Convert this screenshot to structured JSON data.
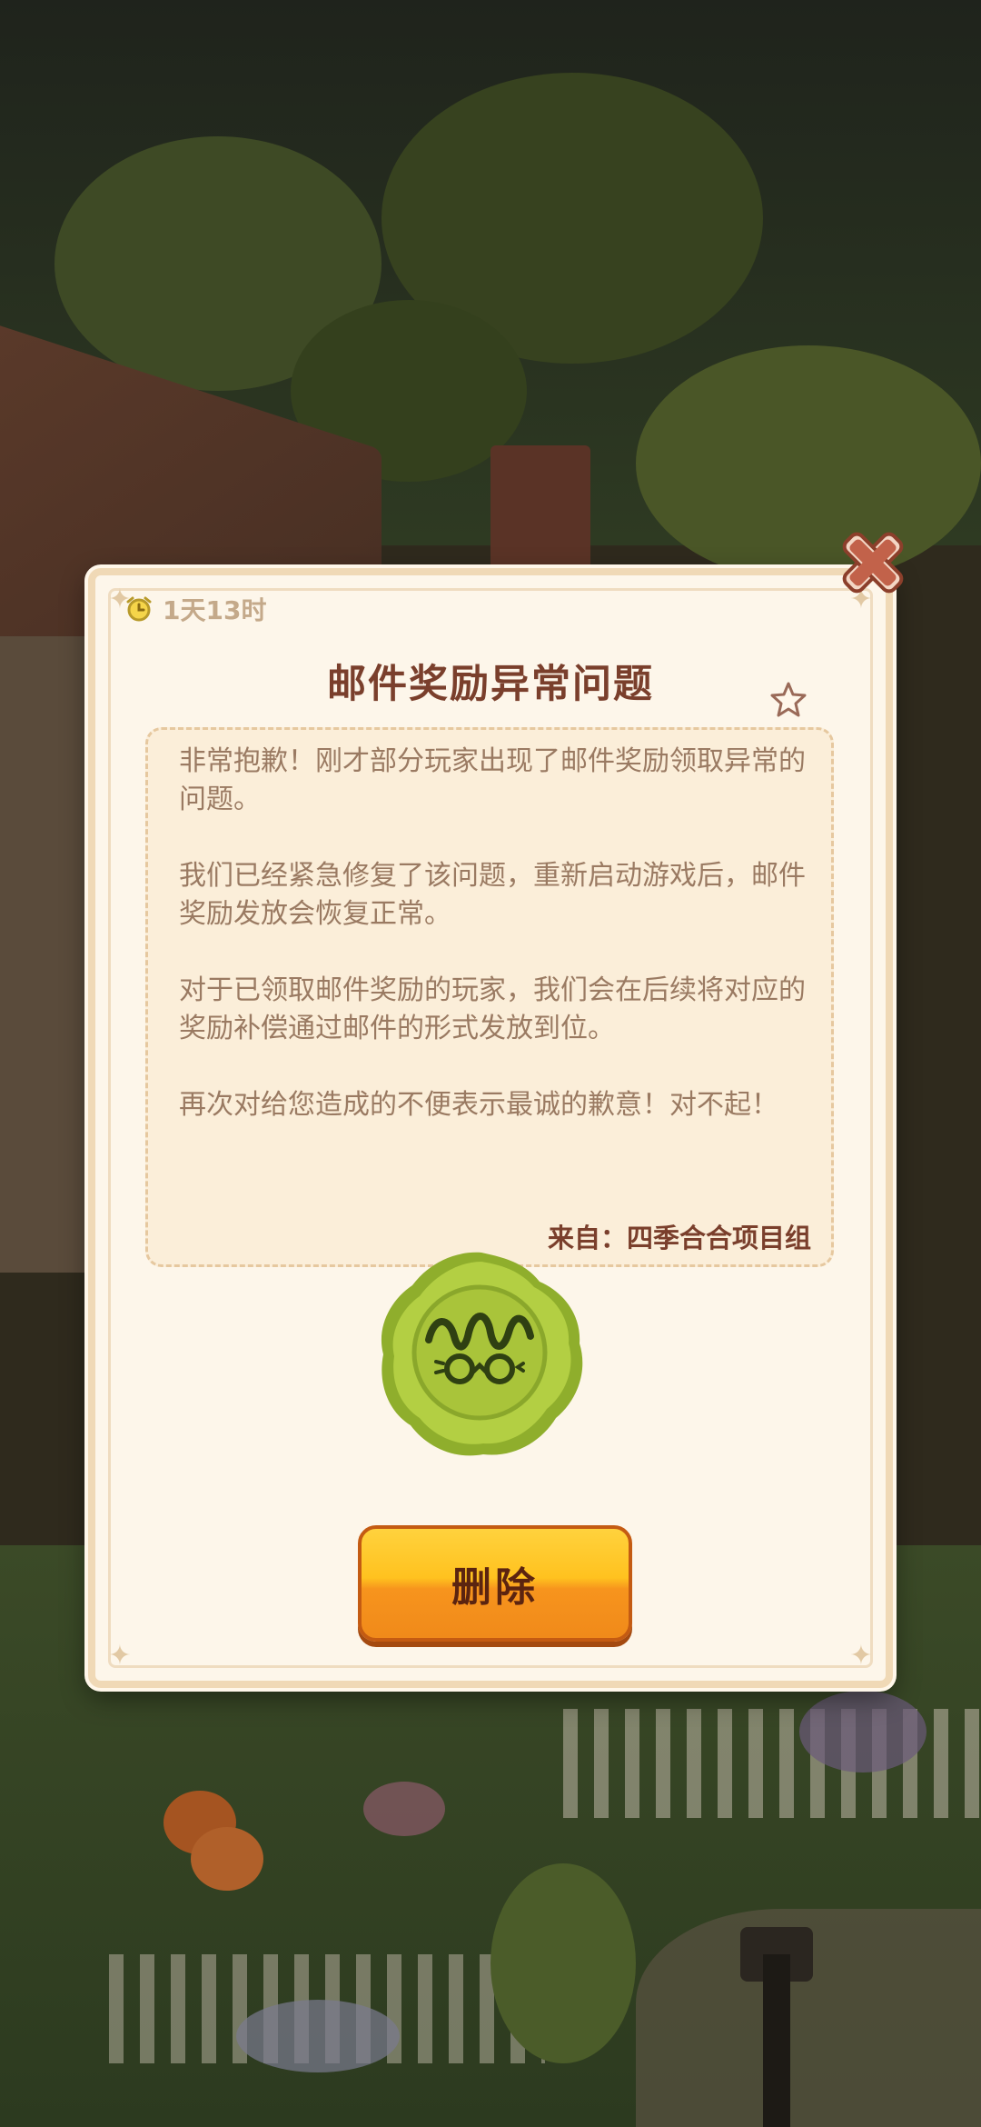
{
  "mail": {
    "timer": "1天13时",
    "title": "邮件奖励异常问题",
    "paragraphs": [
      "非常抱歉！刚才部分玩家出现了邮件奖励领取异常的问题。",
      "我们已经紧急修复了该问题，重新启动游戏后，邮件奖励发放会恢复正常。",
      "对于已领取邮件奖励的玩家，我们会在后续将对应的奖励补偿通过邮件的形式发放到位。",
      "再次对给您造成的不便表示最诚的歉意！对不起！"
    ],
    "sender": "来自：四季合合项目组",
    "delete_label": "删除"
  },
  "icons": {
    "close": "close-icon",
    "timer": "alarm-clock-icon",
    "star": "star-icon",
    "seal": "wax-seal-icon"
  },
  "colors": {
    "title": "#7a3f2c",
    "body_text": "#9a7a62",
    "button_top": "#ffd23d",
    "button_bottom": "#f08a1a",
    "seal": "#a9c43a"
  }
}
